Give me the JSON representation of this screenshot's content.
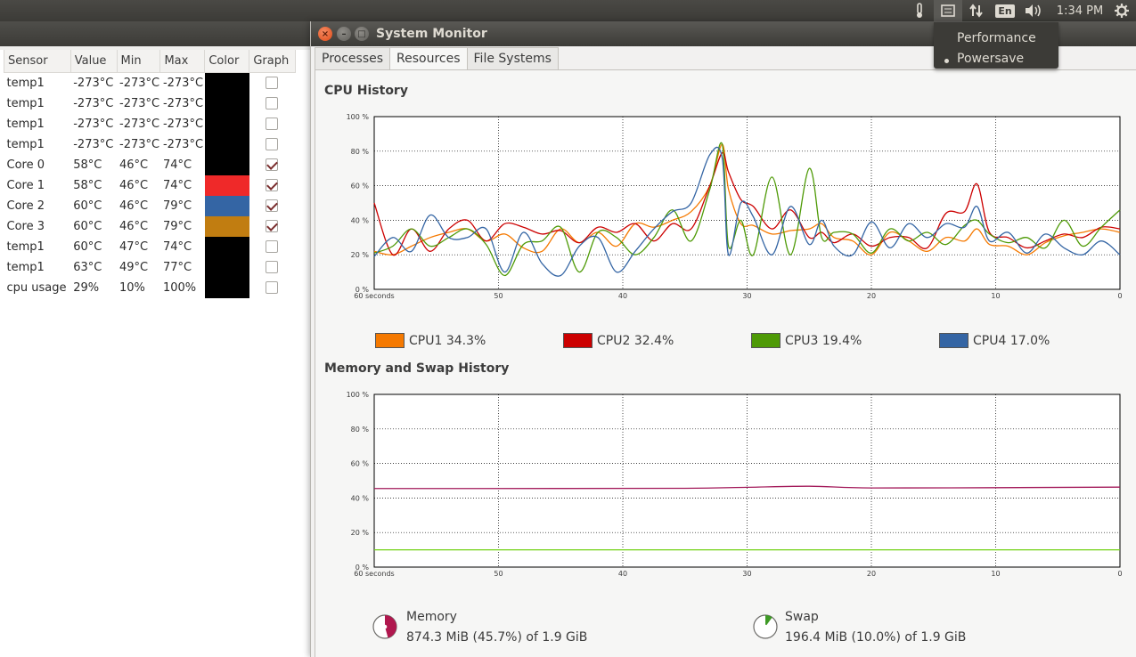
{
  "topbar": {
    "clock": "1:34 PM",
    "language": "En",
    "icons": [
      "thermometer-icon",
      "cpu-frequency-icon",
      "network-icon",
      "keyboard-language-icon",
      "volume-icon",
      "gear-icon"
    ]
  },
  "power_menu": {
    "items": [
      {
        "label": "Performance",
        "selected": false
      },
      {
        "label": "Powersave",
        "selected": true
      }
    ]
  },
  "sensors": {
    "headers": [
      "Sensor",
      "Value",
      "Min",
      "Max",
      "Color",
      "Graph"
    ],
    "rows": [
      {
        "sensor": "temp1",
        "value": "-273°C",
        "min": "-273°C",
        "max": "-273°C",
        "color": "#000000",
        "graph": false
      },
      {
        "sensor": "temp1",
        "value": "-273°C",
        "min": "-273°C",
        "max": "-273°C",
        "color": "#000000",
        "graph": false
      },
      {
        "sensor": "temp1",
        "value": "-273°C",
        "min": "-273°C",
        "max": "-273°C",
        "color": "#000000",
        "graph": false
      },
      {
        "sensor": "temp1",
        "value": "-273°C",
        "min": "-273°C",
        "max": "-273°C",
        "color": "#000000",
        "graph": false
      },
      {
        "sensor": "Core 0",
        "value": "58°C",
        "min": "46°C",
        "max": "74°C",
        "color": "#000000",
        "graph": true
      },
      {
        "sensor": "Core 1",
        "value": "58°C",
        "min": "46°C",
        "max": "74°C",
        "color": "#ef2929",
        "graph": true
      },
      {
        "sensor": "Core 2",
        "value": "60°C",
        "min": "46°C",
        "max": "79°C",
        "color": "#3465a4",
        "graph": true
      },
      {
        "sensor": "Core 3",
        "value": "60°C",
        "min": "46°C",
        "max": "79°C",
        "color": "#c17d11",
        "graph": true
      },
      {
        "sensor": "temp1",
        "value": "60°C",
        "min": "47°C",
        "max": "74°C",
        "color": "#000000",
        "graph": false
      },
      {
        "sensor": "temp1",
        "value": "63°C",
        "min": "49°C",
        "max": "77°C",
        "color": "#000000",
        "graph": false
      },
      {
        "sensor": "cpu usage",
        "value": "29%",
        "min": "10%",
        "max": "100%",
        "color": "#000000",
        "graph": false
      }
    ]
  },
  "monitor": {
    "title": "System Monitor",
    "tabs": [
      {
        "label": "Processes",
        "active": false
      },
      {
        "label": "Resources",
        "active": true
      },
      {
        "label": "File Systems",
        "active": false
      }
    ],
    "cpu_section_title": "CPU History",
    "mem_section_title": "Memory and Swap History",
    "memory": {
      "label": "Memory",
      "detail": "874.3 MiB (45.7%) of 1.9 GiB",
      "fraction": 0.457,
      "color": "#b0174e"
    },
    "swap": {
      "label": "Swap",
      "detail": "196.4 MiB (10.0%) of 1.9 GiB",
      "fraction": 0.1,
      "color": "#3e9a26"
    }
  },
  "chart_data": [
    {
      "type": "line",
      "title": "CPU History",
      "x_tick_labels": [
        "60 seconds",
        "50",
        "40",
        "30",
        "20",
        "10",
        "0"
      ],
      "y_tick_labels": [
        "100 %",
        "80 %",
        "60 %",
        "40 %",
        "20 %",
        "0 %"
      ],
      "xlim": [
        60,
        0
      ],
      "ylim": [
        0,
        100
      ],
      "grid": true,
      "legend_position": "bottom",
      "x": [
        60,
        58.5,
        57,
        55.5,
        54,
        52.5,
        51,
        49.5,
        48,
        46.5,
        45,
        43.5,
        42,
        40.5,
        39,
        37.5,
        36,
        34.5,
        33,
        32,
        31.5,
        30.5,
        29.5,
        28,
        26.5,
        25,
        24,
        23,
        21.5,
        20,
        18.5,
        17,
        15.5,
        14,
        12.5,
        11.5,
        10.5,
        9,
        7.5,
        6,
        4.5,
        3,
        1.5,
        0
      ],
      "series": [
        {
          "name": "CPU1",
          "legend": "CPU1  34.3%",
          "color": "#f57900",
          "values": [
            22,
            20,
            25,
            30,
            33,
            35,
            28,
            32,
            24,
            22,
            35,
            27,
            33,
            25,
            38,
            36,
            40,
            45,
            60,
            84,
            58,
            38,
            37,
            32,
            34,
            35,
            38,
            30,
            28,
            20,
            33,
            28,
            22,
            30,
            28,
            35,
            26,
            25,
            20,
            27,
            31,
            33,
            35,
            33
          ]
        },
        {
          "name": "CPU2",
          "legend": "CPU2  32.4%",
          "color": "#cc0000",
          "values": [
            50,
            20,
            35,
            22,
            35,
            40,
            28,
            38,
            36,
            32,
            34,
            27,
            36,
            33,
            38,
            28,
            38,
            35,
            60,
            79,
            68,
            52,
            48,
            35,
            46,
            30,
            33,
            27,
            32,
            25,
            30,
            30,
            24,
            44,
            45,
            61,
            33,
            30,
            24,
            28,
            32,
            30,
            36,
            35
          ]
        },
        {
          "name": "CPU3",
          "legend": "CPU3  19.4%",
          "color": "#4e9a06",
          "values": [
            21,
            25,
            35,
            25,
            30,
            35,
            26,
            8,
            26,
            28,
            36,
            10,
            33,
            30,
            20,
            30,
            46,
            28,
            58,
            84,
            25,
            40,
            20,
            65,
            20,
            70,
            30,
            33,
            32,
            21,
            35,
            28,
            33,
            26,
            37,
            40,
            32,
            27,
            30,
            24,
            40,
            25,
            36,
            46
          ]
        },
        {
          "name": "CPU4",
          "legend": "CPU4  17.0%",
          "color": "#3465a4",
          "values": [
            19,
            30,
            22,
            43,
            30,
            30,
            35,
            10,
            33,
            15,
            8,
            25,
            30,
            10,
            22,
            35,
            45,
            50,
            78,
            76,
            20,
            50,
            42,
            20,
            48,
            26,
            40,
            25,
            20,
            39,
            24,
            38,
            30,
            38,
            36,
            48,
            28,
            33,
            21,
            32,
            24,
            20,
            28,
            20
          ]
        }
      ]
    },
    {
      "type": "line",
      "title": "Memory and Swap History",
      "x_tick_labels": [
        "60 seconds",
        "50",
        "40",
        "30",
        "20",
        "10",
        "0"
      ],
      "y_tick_labels": [
        "100 %",
        "80 %",
        "60 %",
        "40 %",
        "20 %",
        "0 %"
      ],
      "xlim": [
        60,
        0
      ],
      "ylim": [
        0,
        100
      ],
      "grid": true,
      "series": [
        {
          "name": "Memory",
          "color": "#a31a5a",
          "x": [
            60,
            45,
            35,
            30,
            25,
            20,
            10,
            0
          ],
          "values": [
            45.5,
            45.5,
            45.6,
            46.2,
            46.8,
            45.8,
            46.0,
            46.3
          ]
        },
        {
          "name": "Swap",
          "color": "#73d216",
          "x": [
            60,
            0
          ],
          "values": [
            10,
            10
          ]
        }
      ]
    }
  ]
}
